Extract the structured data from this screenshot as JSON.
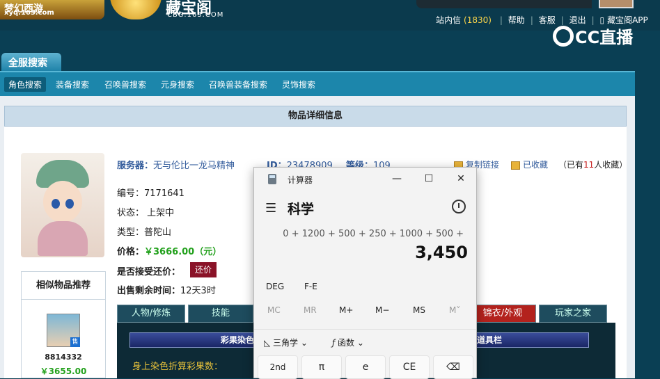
{
  "header": {
    "game_logo": "梦幻西游",
    "game_logo_sub": "xyq.163.com",
    "cbg_logo": "藏宝阁",
    "cbg_sub": "CBG.163.COM",
    "links": {
      "mail": "站内信",
      "mail_count": "(1830)",
      "help": "帮助",
      "service": "客服",
      "logout": "退出",
      "app": "藏宝阁APP"
    },
    "watermark": "CC直播"
  },
  "search_tab": "全服搜索",
  "nav": {
    "items": [
      "角色搜索",
      "装备搜索",
      "召唤兽搜索",
      "元身搜索",
      "召唤兽装备搜索",
      "灵饰搜索"
    ],
    "active_index": 0
  },
  "panel_title": "物品详细信息",
  "item": {
    "server_label": "服务器：",
    "server_value": "无与伦比一龙马精神",
    "id_label": "ID：",
    "id_value": "23478909",
    "level_label": "等级：",
    "level_value": "109",
    "number": "编号：7171641",
    "status": "状态：  上架中",
    "type": "类型：普陀山",
    "price_label": "价格：",
    "price_value": "￥3666.00（元）",
    "counter_label": "是否接受还价：",
    "counter_button": "还价",
    "time_label": "出售剩余时间：",
    "time_value": "12天3时",
    "copy_link": "复制链接",
    "favorited": "已收藏",
    "fav_prefix": "（已有",
    "fav_count": "11",
    "fav_suffix": "人收藏）"
  },
  "similar": {
    "title": "相似物品推荐",
    "badge": "售",
    "id": "8814332",
    "price": "￥3655.00"
  },
  "subtabs": [
    "人物/修炼",
    "技能",
    "锦衣/外观",
    "玩家之家"
  ],
  "lower": {
    "bar_left": "彩果染色",
    "bar_right": "道具栏",
    "dye_label": "身上染色折算彩果数："
  },
  "calculator": {
    "title": "计算器",
    "mode": "科学",
    "expression": "0 + 1200 + 500 + 250 + 1000 + 500 +",
    "result": "3,450",
    "deg": "DEG",
    "fe": "F-E",
    "memory": [
      "MC",
      "MR",
      "M+",
      "M−",
      "MS",
      "M˅"
    ],
    "trig": "三角学",
    "func": "函数",
    "keys": [
      "2nd",
      "π",
      "e",
      "CE",
      "⌫"
    ]
  }
}
